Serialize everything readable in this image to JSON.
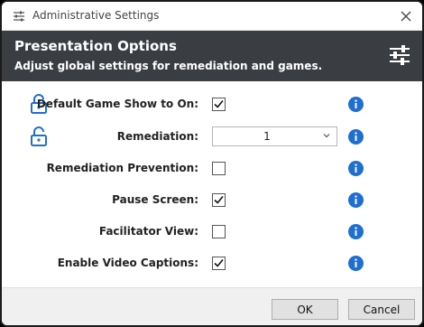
{
  "window": {
    "title": "Administrative Settings",
    "title_icon": "sliders-icon",
    "close_icon": "close-icon"
  },
  "header": {
    "title": "Presentation Options",
    "subtitle": "Adjust global settings for remediation and games.",
    "icon": "sliders-icon"
  },
  "settings": [
    {
      "label": "Default Game Show to On:",
      "control": "checkbox",
      "checked": true,
      "locked": true
    },
    {
      "label": "Remediation:",
      "control": "select",
      "value": "1",
      "locked": true
    },
    {
      "label": "Remediation Prevention:",
      "control": "checkbox",
      "checked": false,
      "locked": false
    },
    {
      "label": "Pause Screen:",
      "control": "checkbox",
      "checked": true,
      "locked": false
    },
    {
      "label": "Facilitator View:",
      "control": "checkbox",
      "checked": false,
      "locked": false
    },
    {
      "label": "Enable Video Captions:",
      "control": "checkbox",
      "checked": true,
      "locked": false
    }
  ],
  "footer": {
    "ok_label": "OK",
    "cancel_label": "Cancel"
  },
  "colors": {
    "header_bg": "#3a3e43",
    "info_blue": "#1e6fd1",
    "lock_blue": "#1e6fd1"
  }
}
